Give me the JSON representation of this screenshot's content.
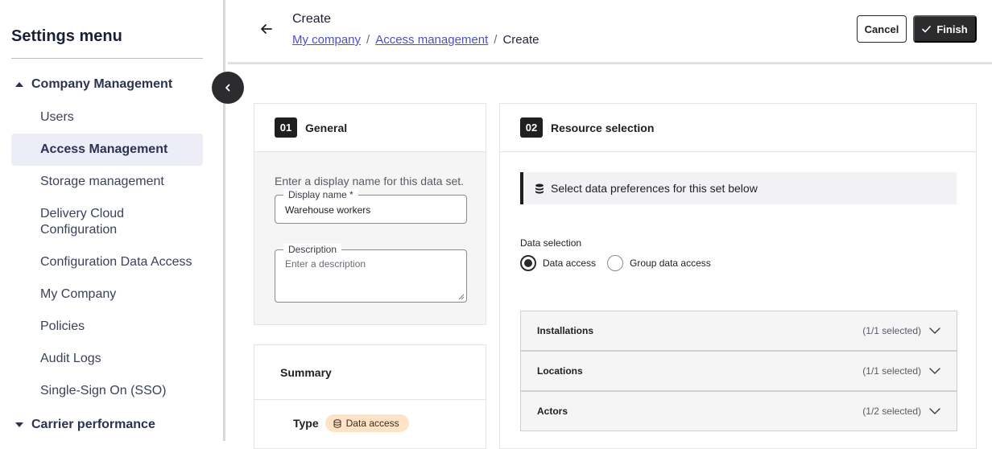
{
  "sidebar": {
    "title": "Settings menu",
    "groups": [
      {
        "label": "Company Management"
      },
      {
        "label": "Carrier performance"
      }
    ],
    "items": [
      {
        "label": "Users"
      },
      {
        "label": "Access Management"
      },
      {
        "label": "Storage management"
      },
      {
        "label": "Delivery Cloud Configuration"
      },
      {
        "label": "Configuration Data Access"
      },
      {
        "label": "My Company"
      },
      {
        "label": "Policies"
      },
      {
        "label": "Audit Logs"
      },
      {
        "label": "Single-Sign On (SSO)"
      }
    ],
    "active_item": "Access Management"
  },
  "header": {
    "title": "Create",
    "breadcrumb": [
      {
        "label": "My company"
      },
      {
        "label": "Access management"
      },
      {
        "label": "Create"
      }
    ],
    "separator": "/",
    "cancel_label": "Cancel",
    "finish_label": "Finish"
  },
  "general": {
    "step": "01",
    "title": "General",
    "hint": "Enter a display name for this data set.",
    "display_name_label": "Display name *",
    "display_name_value": "Warehouse workers",
    "description_label": "Description",
    "description_placeholder": "Enter a description"
  },
  "summary": {
    "title": "Summary",
    "type_label": "Type",
    "type_value": "Data access"
  },
  "resource": {
    "step": "02",
    "title": "Resource selection",
    "notice": "Select data preferences for this set below",
    "data_selection_label": "Data selection",
    "options": [
      {
        "label": "Data access",
        "selected": true
      },
      {
        "label": "Group data access",
        "selected": false
      }
    ],
    "accordions": [
      {
        "title": "Installations",
        "count": "(1/1 selected)"
      },
      {
        "title": "Locations",
        "count": "(1/1 selected)"
      },
      {
        "title": "Actors",
        "count": "(1/2 selected)"
      }
    ]
  },
  "colors": {
    "active_bg": "#ecedf6",
    "link": "#4b4fc7",
    "dark": "#2c2c2e",
    "pill": "#fde4c6"
  }
}
